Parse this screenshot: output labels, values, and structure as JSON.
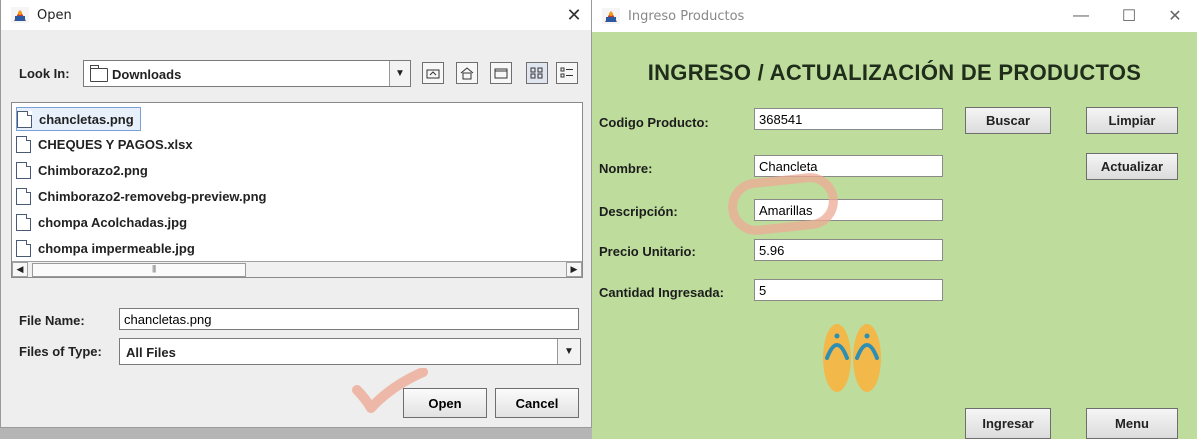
{
  "open_dialog": {
    "title": "Open",
    "close_glyph": "✕",
    "look_in_label": "Look In:",
    "look_in_value": "Downloads",
    "files": [
      "chancletas.png",
      "CHEQUES Y PAGOS.xlsx",
      "Chimborazo2.png",
      "Chimborazo2-removebg-preview.png",
      "chompa Acolchadas.jpg",
      "chompa impermeable.jpg"
    ],
    "selected_index": 0,
    "file_name_label": "File Name:",
    "file_name_value": "chancletas.png",
    "files_of_type_label": "Files of Type:",
    "files_of_type_value": "All Files",
    "open_label": "Open",
    "cancel_label": "Cancel"
  },
  "ingreso": {
    "title": "Ingreso Productos",
    "heading": "INGRESO / ACTUALIZACIÓN DE PRODUCTOS",
    "fields": {
      "codigo": {
        "label": "Codigo Producto:",
        "value": "368541"
      },
      "nombre": {
        "label": "Nombre:",
        "value": "Chancleta"
      },
      "descripcion": {
        "label": "Descripción:",
        "value": "Amarillas"
      },
      "precio": {
        "label": "Precio Unitario:",
        "value": "5.96"
      },
      "cantidad": {
        "label": "Cantidad Ingresada:",
        "value": "5"
      }
    },
    "buttons": {
      "buscar": "Buscar",
      "limpiar": "Limpiar",
      "actualizar": "Actualizar",
      "ingresar": "Ingresar",
      "menu": "Menu"
    },
    "window_controls": {
      "minimize": "—",
      "maximize": "☐",
      "close": "✕"
    }
  },
  "colors": {
    "form_background": "#bedd9d",
    "annotation": "#ecaa96"
  },
  "icons": [
    "java-app-icon",
    "folder-icon",
    "file-icon",
    "flip-flops-image",
    "checkmark-annotation"
  ]
}
